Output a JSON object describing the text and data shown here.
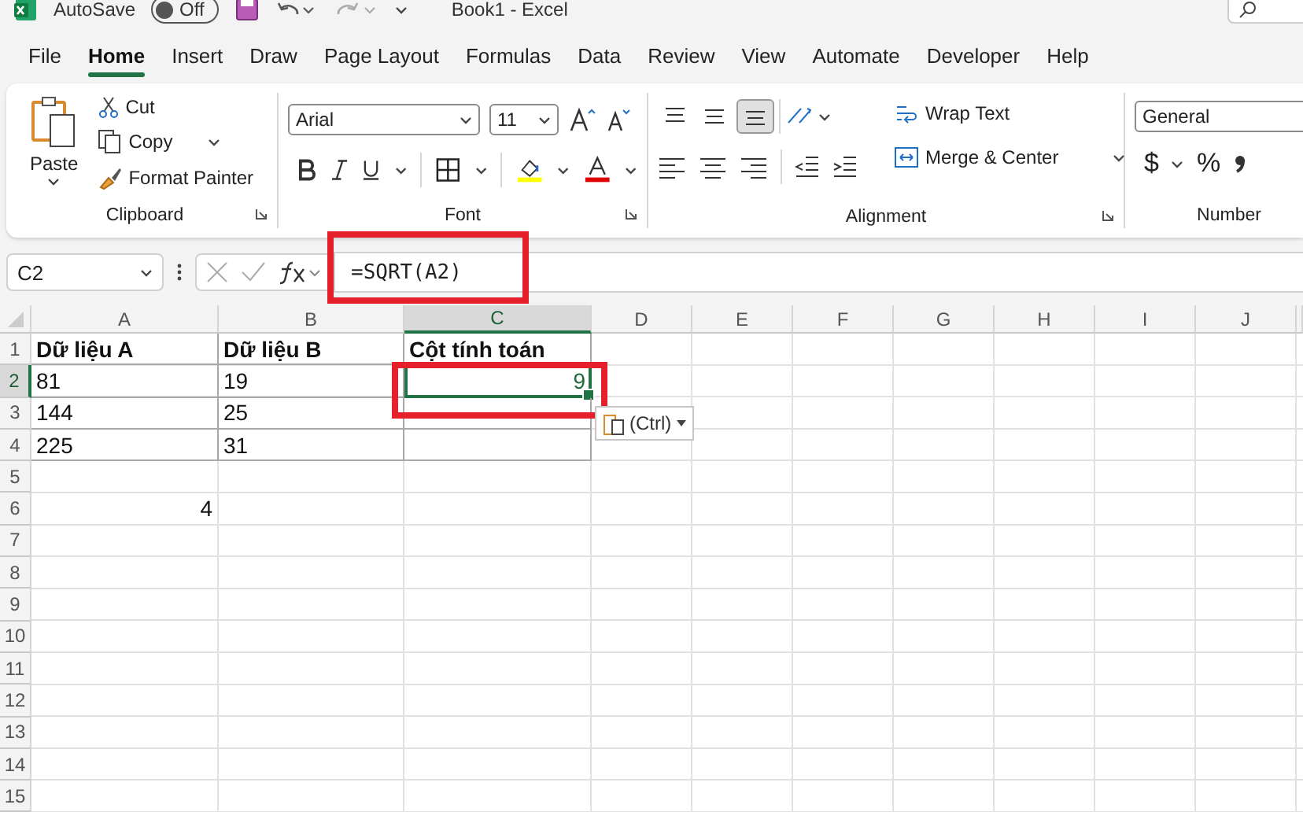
{
  "title_bar": {
    "autosave_label": "AutoSave",
    "autosave_toggle": {
      "label": "Off",
      "on": false
    },
    "document_title": "Book1  -  Excel"
  },
  "menu_tabs": [
    {
      "label": "File",
      "selected": false
    },
    {
      "label": "Home",
      "selected": true
    },
    {
      "label": "Insert",
      "selected": false
    },
    {
      "label": "Draw",
      "selected": false
    },
    {
      "label": "Page Layout",
      "selected": false
    },
    {
      "label": "Formulas",
      "selected": false
    },
    {
      "label": "Data",
      "selected": false
    },
    {
      "label": "Review",
      "selected": false
    },
    {
      "label": "View",
      "selected": false
    },
    {
      "label": "Automate",
      "selected": false
    },
    {
      "label": "Developer",
      "selected": false
    },
    {
      "label": "Help",
      "selected": false
    }
  ],
  "ribbon": {
    "clipboard": {
      "paste": "Paste",
      "cut": "Cut",
      "copy": "Copy",
      "format_painter": "Format Painter",
      "group_label": "Clipboard"
    },
    "font": {
      "font_name": "Arial",
      "font_size": "11",
      "group_label": "Font"
    },
    "alignment": {
      "vertical_align": [
        {
          "kind": "top",
          "selected": false
        },
        {
          "kind": "middle",
          "selected": false
        },
        {
          "kind": "bottom",
          "selected": true
        }
      ],
      "wrap_text": "Wrap Text",
      "merge_center": "Merge & Center",
      "group_label": "Alignment"
    },
    "number": {
      "format": "General",
      "currency": "$",
      "percent": "%",
      "group_label": "Number"
    }
  },
  "formula_bar": {
    "name_box": "C2",
    "formula": "=SQRT(A2)"
  },
  "sheet": {
    "columns": [
      {
        "label": "A",
        "selected": false
      },
      {
        "label": "B",
        "selected": false
      },
      {
        "label": "C",
        "selected": true
      },
      {
        "label": "D",
        "selected": false
      },
      {
        "label": "E",
        "selected": false
      },
      {
        "label": "F",
        "selected": false
      },
      {
        "label": "G",
        "selected": false
      },
      {
        "label": "H",
        "selected": false
      },
      {
        "label": "I",
        "selected": false
      },
      {
        "label": "J",
        "selected": false
      }
    ],
    "rows": [
      {
        "label": "1",
        "selected": false,
        "bordered": true,
        "cells": [
          {
            "text": "Dữ liệu A",
            "kind": "header"
          },
          {
            "text": "Dữ liệu B",
            "kind": "header"
          },
          {
            "text": "Cột tính toán",
            "kind": "header"
          }
        ]
      },
      {
        "label": "2",
        "selected": true,
        "bordered": true,
        "cells": [
          {
            "text": "81",
            "kind": "text"
          },
          {
            "text": "19",
            "kind": "text"
          },
          {
            "text": "9",
            "kind": "number"
          }
        ]
      },
      {
        "label": "3",
        "selected": false,
        "bordered": true,
        "cells": [
          {
            "text": "144",
            "kind": "text"
          },
          {
            "text": "25",
            "kind": "text"
          }
        ]
      },
      {
        "label": "4",
        "selected": false,
        "bordered": true,
        "cells": [
          {
            "text": "225",
            "kind": "text"
          },
          {
            "text": "31",
            "kind": "text"
          }
        ]
      },
      {
        "label": "5",
        "selected": false,
        "bordered": false
      },
      {
        "label": "6",
        "selected": false,
        "bordered": false,
        "cells": [
          {
            "text": "4",
            "kind": "number"
          }
        ]
      },
      {
        "label": "7",
        "selected": false,
        "bordered": false
      },
      {
        "label": "8",
        "selected": false,
        "bordered": false
      },
      {
        "label": "9",
        "selected": false,
        "bordered": false
      },
      {
        "label": "10",
        "selected": false,
        "bordered": false
      },
      {
        "label": "11",
        "selected": false,
        "bordered": false
      },
      {
        "label": "12",
        "selected": false,
        "bordered": false
      },
      {
        "label": "13",
        "selected": false,
        "bordered": false
      },
      {
        "label": "14",
        "selected": false,
        "bordered": false
      },
      {
        "label": "15",
        "selected": false,
        "bordered": false
      }
    ],
    "paste_options": {
      "label": "(Ctrl)"
    }
  }
}
